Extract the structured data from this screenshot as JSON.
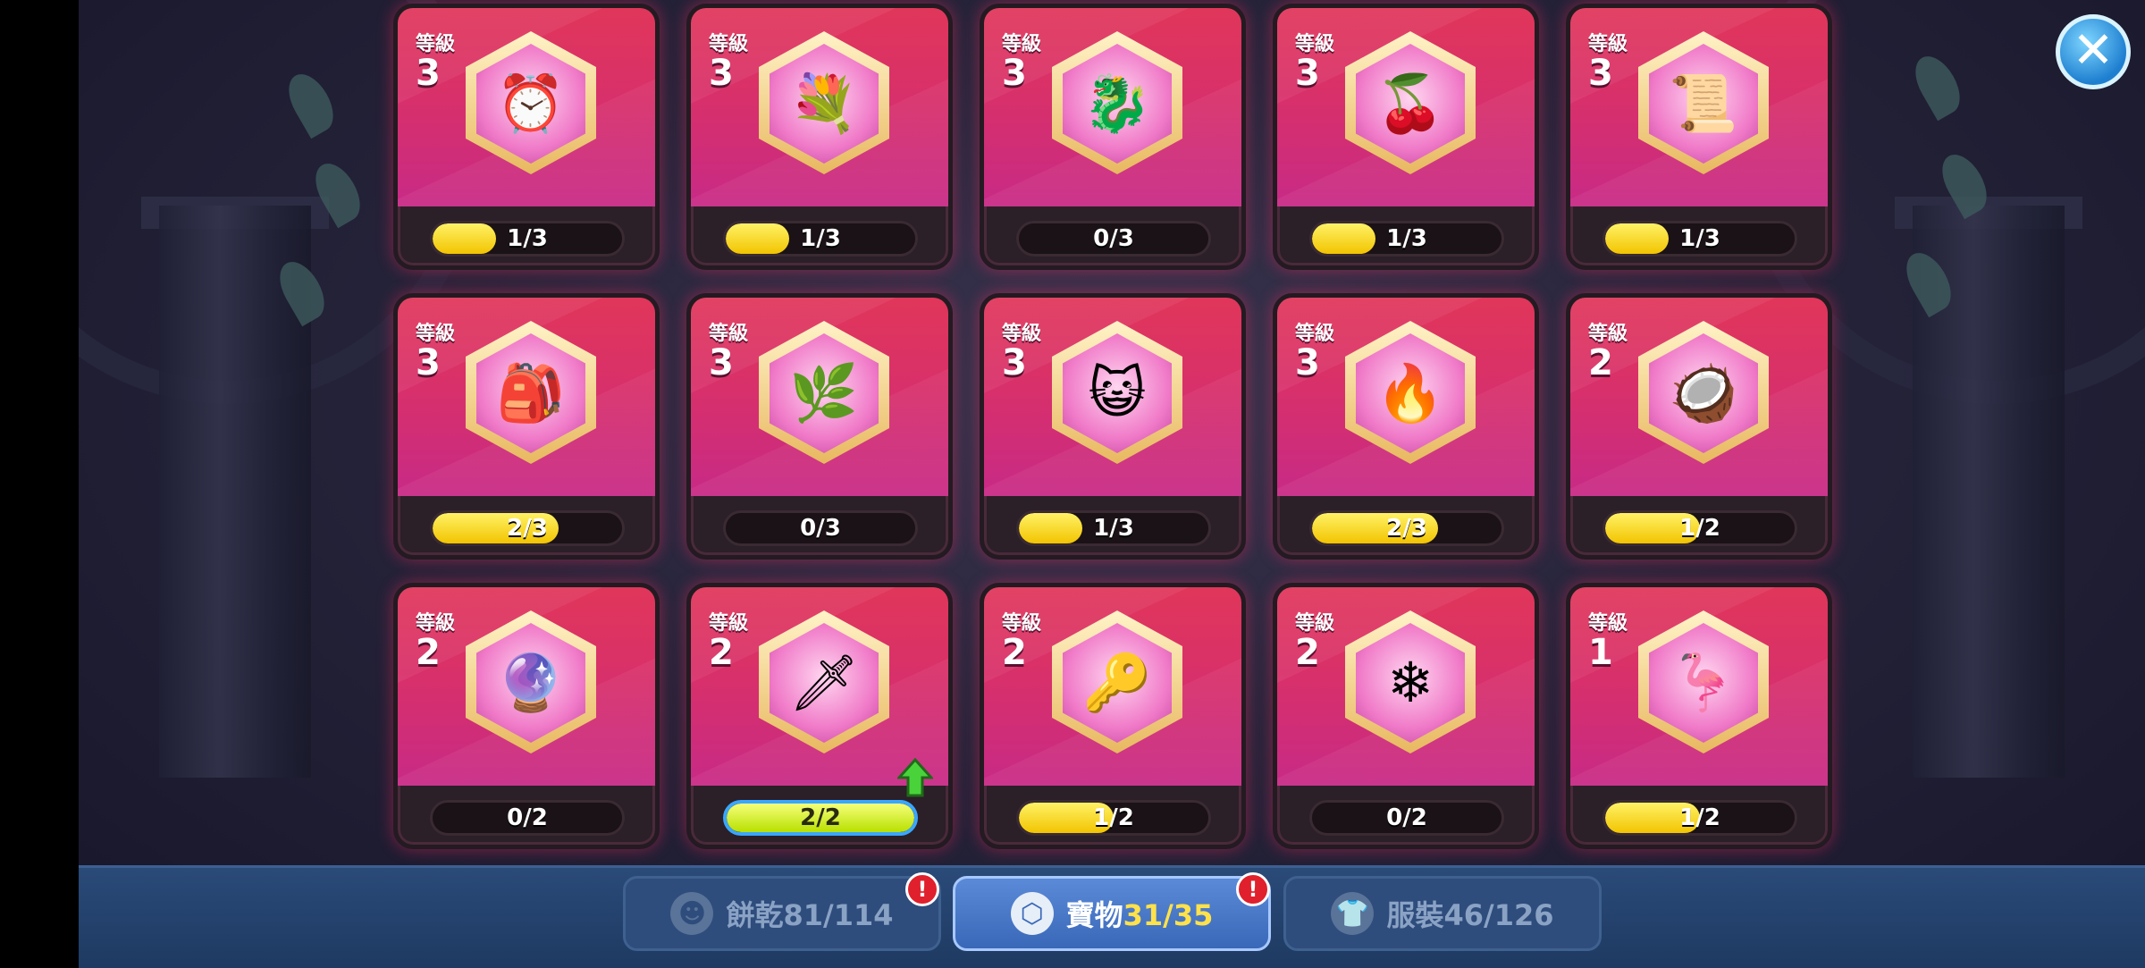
{
  "close_label": "✕",
  "level_label": "等級",
  "cards": [
    {
      "level": "3",
      "progress": "1/3",
      "fill": 0.333,
      "icon": "⏰",
      "icon_name": "clock-treasure-icon"
    },
    {
      "level": "3",
      "progress": "1/3",
      "fill": 0.333,
      "icon": "💐",
      "icon_name": "flower-wreath-treasure-icon"
    },
    {
      "level": "3",
      "progress": "0/3",
      "fill": 0,
      "icon": "🐉",
      "icon_name": "dragon-wing-treasure-icon"
    },
    {
      "level": "3",
      "progress": "1/3",
      "fill": 0.333,
      "icon": "🍒",
      "icon_name": "berry-treasure-icon"
    },
    {
      "level": "3",
      "progress": "1/3",
      "fill": 0.333,
      "icon": "📜",
      "icon_name": "mummy-wrap-treasure-icon"
    },
    {
      "level": "3",
      "progress": "2/3",
      "fill": 0.667,
      "icon": "🎒",
      "icon_name": "blue-pouch-treasure-icon"
    },
    {
      "level": "3",
      "progress": "0/3",
      "fill": 0,
      "icon": "🌿",
      "icon_name": "frost-branch-treasure-icon"
    },
    {
      "level": "3",
      "progress": "1/3",
      "fill": 0.333,
      "icon": "😺",
      "icon_name": "jelly-cat-treasure-icon"
    },
    {
      "level": "3",
      "progress": "2/3",
      "fill": 0.667,
      "icon": "🔥",
      "icon_name": "flame-crown-treasure-icon"
    },
    {
      "level": "2",
      "progress": "1/2",
      "fill": 0.5,
      "icon": "🥥",
      "icon_name": "coconut-treasure-icon"
    },
    {
      "level": "2",
      "progress": "0/2",
      "fill": 0,
      "icon": "🔮",
      "icon_name": "magnifier-locket-treasure-icon"
    },
    {
      "level": "2",
      "progress": "2/2",
      "fill": 1,
      "icon": "🗡",
      "icon_name": "crystal-claw-treasure-icon",
      "upgrade": true
    },
    {
      "level": "2",
      "progress": "1/2",
      "fill": 0.5,
      "icon": "🔑",
      "icon_name": "emerald-key-treasure-icon"
    },
    {
      "level": "2",
      "progress": "0/2",
      "fill": 0,
      "icon": "❄",
      "icon_name": "ice-crystal-treasure-icon"
    },
    {
      "level": "1",
      "progress": "1/2",
      "fill": 0.5,
      "icon": "🦩",
      "icon_name": "flamingo-float-treasure-icon"
    }
  ],
  "tabs": [
    {
      "label": "餅乾",
      "count": "81/114",
      "icon": "☻",
      "icon_name": "cookie-icon",
      "badge": "!"
    },
    {
      "label": "寶物",
      "count": "31/35",
      "icon": "⬡",
      "icon_name": "treasure-hex-icon",
      "badge": "!"
    },
    {
      "label": "服裝",
      "count": "46/126",
      "icon": "👕",
      "icon_name": "costume-shirt-icon"
    }
  ],
  "colors": {
    "accent": "#3aa6ff",
    "progress_fill": "#f2c400",
    "card_bg": "#d8306a",
    "badge": "#e0202c"
  }
}
